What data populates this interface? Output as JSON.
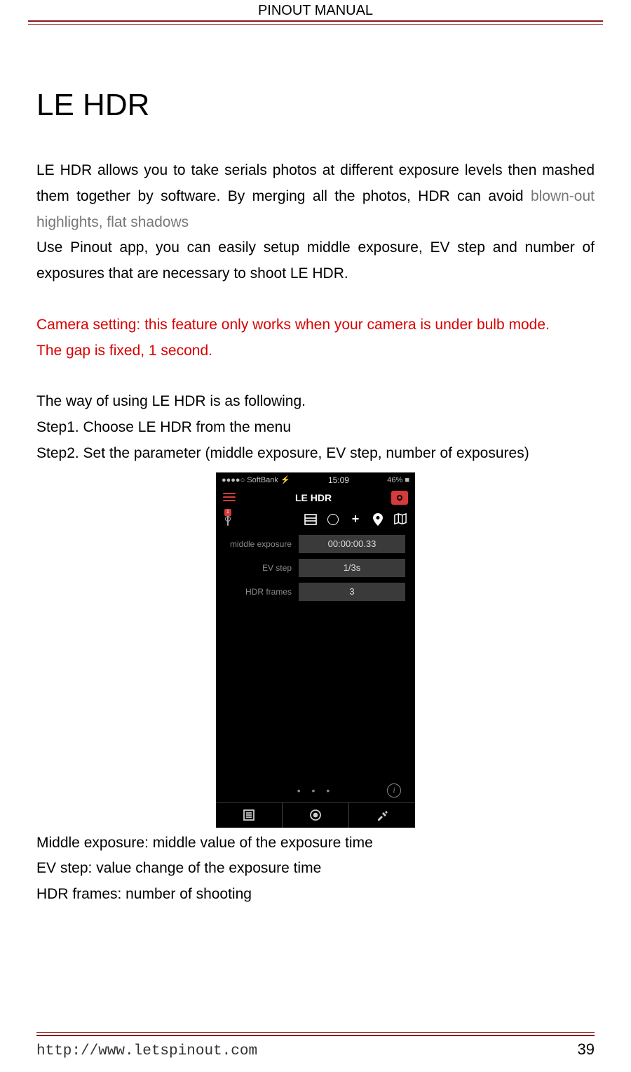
{
  "header": {
    "title": "PINOUT MANUAL"
  },
  "h1": "LE HDR",
  "para1a": "LE HDR allows you to take serials photos at different exposure levels then mashed them together by software. By merging all the photos, HDR can avoid ",
  "para1b": "blown-out highlights, flat shadows",
  "para2": "Use Pinout app, you can easily setup middle exposure, EV step and number of exposures that are necessary to shoot LE HDR.",
  "warn1": "Camera setting: this feature only works when your camera is under bulb mode.",
  "warn2": "The gap is fixed, 1 second.",
  "intro": "The way of using LE HDR is as following.",
  "step1": "Step1. Choose LE HDR from the menu",
  "step2": "Step2. Set the parameter (middle exposure, EV step, number of exposures)",
  "phone": {
    "status": {
      "carrier": "●●●●○ SoftBank ⚡",
      "time": "15:09",
      "right": "  46% ■"
    },
    "title": "LE HDR",
    "badge": "1",
    "rows": {
      "middle": {
        "label": "middle exposure",
        "value": "00:00:00.33"
      },
      "ev": {
        "label": "EV step",
        "value": "1/3s"
      },
      "frames": {
        "label": "HDR frames",
        "value": "3"
      }
    },
    "dots": "• • •",
    "info": "i"
  },
  "def1": "Middle exposure: middle value of the exposure time",
  "def2": "EV step: value change of the exposure time",
  "def3": "HDR frames: number of shooting",
  "footer": {
    "url": "http://www.letspinout.com",
    "page": "39"
  }
}
